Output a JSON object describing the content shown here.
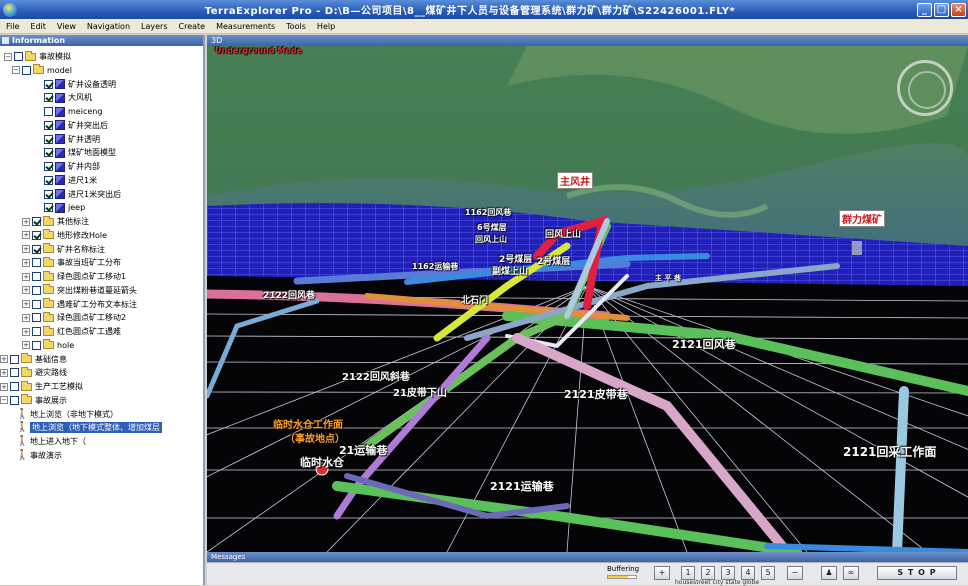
{
  "window": {
    "title": "TerraExplorer Pro - D:\\B—公司项目\\8__煤矿井下人员与设备管理系统\\群力矿\\群力矿\\S22426001.FLY*",
    "buttons": {
      "minimize": "_",
      "maximize": "□",
      "close": "×"
    }
  },
  "menu": [
    "File",
    "Edit",
    "View",
    "Navigation",
    "Layers",
    "Create",
    "Measurements",
    "Tools",
    "Help"
  ],
  "panel": {
    "title": "Information"
  },
  "tree": [
    {
      "label": "事故模拟",
      "icon": "folder",
      "checked": false
    },
    {
      "label": "model",
      "icon": "folder",
      "checked": false
    },
    {
      "label": "矿井设备透明",
      "icon": "cube",
      "checked": true
    },
    {
      "label": "大风机",
      "icon": "cube",
      "checked": true
    },
    {
      "label": "meiceng",
      "icon": "cube",
      "checked": false
    },
    {
      "label": "矿井突出后",
      "icon": "cube",
      "checked": true
    },
    {
      "label": "矿井透明",
      "icon": "cube",
      "checked": true
    },
    {
      "label": "煤矿地面模型",
      "icon": "cube",
      "checked": true
    },
    {
      "label": "矿井内部",
      "icon": "cube",
      "checked": true
    },
    {
      "label": "进尺1米",
      "icon": "cube",
      "checked": true
    },
    {
      "label": "进尺1米突出后",
      "icon": "cube",
      "checked": true
    },
    {
      "label": "jeep",
      "icon": "cube",
      "checked": true
    },
    {
      "label": "其他标注",
      "icon": "folder",
      "checked": true
    },
    {
      "label": "地形修改Hole",
      "icon": "folder",
      "checked": true
    },
    {
      "label": "矿井名称标注",
      "icon": "folder",
      "checked": true
    },
    {
      "label": "事故当班矿工分布",
      "icon": "folder",
      "checked": false
    },
    {
      "label": "绿色圆点矿工移动1",
      "icon": "folder",
      "checked": false
    },
    {
      "label": "突出煤粉巷道蔓延箭头",
      "icon": "folder",
      "checked": false
    },
    {
      "label": "遇难矿工分布文本标注",
      "icon": "folder",
      "checked": false
    },
    {
      "label": "绿色圆点矿工移动2",
      "icon": "folder",
      "checked": false
    },
    {
      "label": "红色圆点矿工遇难",
      "icon": "folder",
      "checked": false
    },
    {
      "label": "hole",
      "icon": "folder",
      "checked": false
    },
    {
      "label": "基础信息",
      "icon": "folder",
      "checked": false
    },
    {
      "label": "避灾路线",
      "icon": "folder",
      "checked": false
    },
    {
      "label": "生产工艺模拟",
      "icon": "folder",
      "checked": false
    },
    {
      "label": "事故展示",
      "icon": "folder",
      "checked": false
    },
    {
      "label": "地上浏览（非地下模式）",
      "icon": "walker",
      "checked": false
    },
    {
      "label": "地上浏览（地下模式整体、增加煤层",
      "icon": "walker",
      "checked": false,
      "selected": true
    },
    {
      "label": "地上进入地下（",
      "icon": "walker",
      "checked": false
    },
    {
      "label": "事故演示",
      "icon": "walker",
      "checked": false
    }
  ],
  "view": {
    "header": "3D",
    "mode_text": "Underground Mode",
    "labels": {
      "main_shaft": "主风井",
      "mine_name": "群力煤矿",
      "l1162_return": "1162回风巷",
      "coal6": "6号煤层",
      "return_up": "回风上山",
      "coal2a": "2号煤层",
      "coal2b": "2号煤层",
      "cross": "回风上山",
      "bypass": "副煤上山",
      "l1162_trans": "1162运输巷",
      "main_lane": "主 平 巷",
      "l2122_return": "2122回风巷",
      "north_gate": "北石门",
      "l2121_return": "2121回风巷",
      "l2122_slope": "2122回风斜巷",
      "l21_belt": "21皮带下山",
      "l2121_belt": "2121皮带巷",
      "l2121_face": "2121回采工作面",
      "water_tank": "临时水仓工作面",
      "accident_point": "（事故地点）",
      "temp_tank": "临时水仓",
      "l21_trans": "21运输巷",
      "l2121_trans": "2121运输巷"
    }
  },
  "messages": {
    "title": "Messages"
  },
  "status": {
    "buffering": "Buffering",
    "presets": [
      "1",
      "2",
      "3",
      "4",
      "5"
    ],
    "preset_labels": "housestreet city state globe",
    "stop": "S T O P"
  }
}
